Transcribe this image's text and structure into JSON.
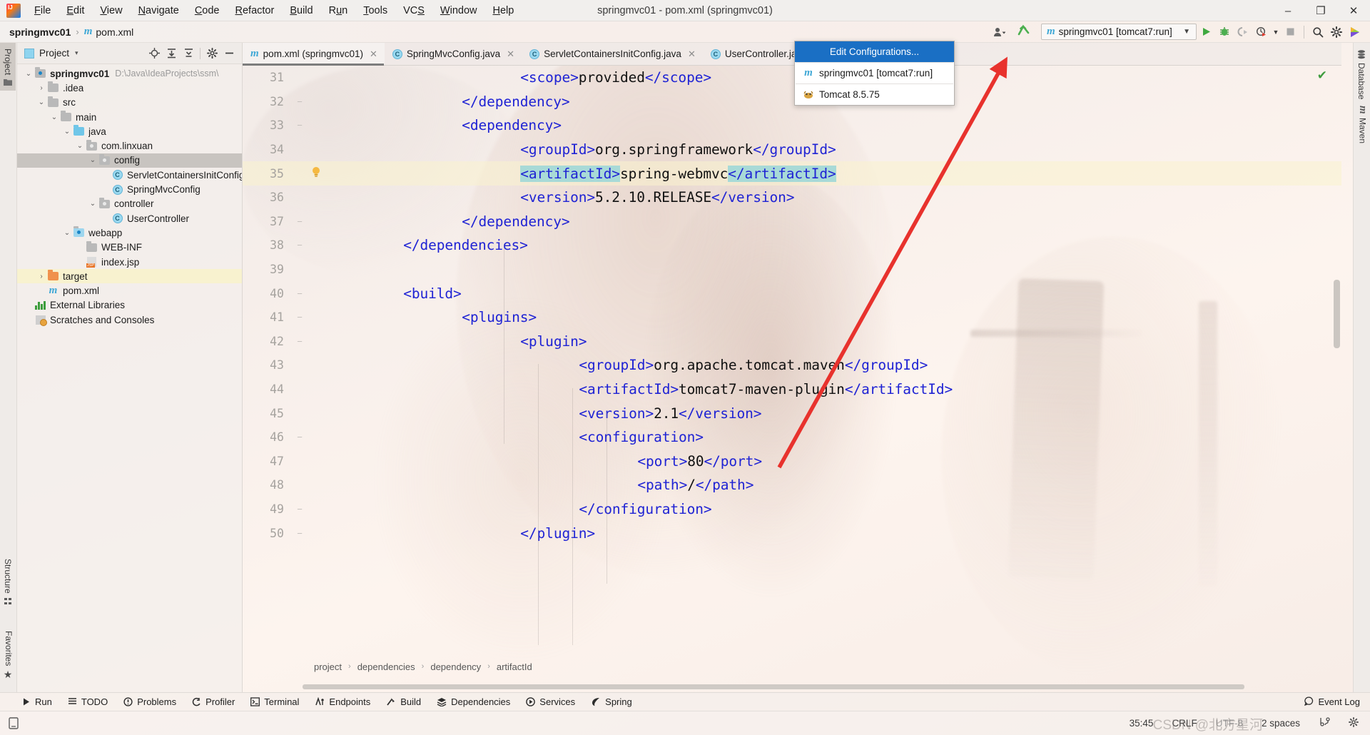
{
  "window": {
    "title": "springmvc01 - pom.xml (springmvc01)",
    "minimize": "–",
    "maximize": "❐",
    "close": "✕"
  },
  "menubar": {
    "items": [
      {
        "label": "File",
        "mnemonic": "F"
      },
      {
        "label": "Edit",
        "mnemonic": "E"
      },
      {
        "label": "View",
        "mnemonic": "V"
      },
      {
        "label": "Navigate",
        "mnemonic": "N"
      },
      {
        "label": "Code",
        "mnemonic": "C"
      },
      {
        "label": "Refactor",
        "mnemonic": "R"
      },
      {
        "label": "Build",
        "mnemonic": "B"
      },
      {
        "label": "Run",
        "mnemonic": "u"
      },
      {
        "label": "Tools",
        "mnemonic": "T"
      },
      {
        "label": "VCS",
        "mnemonic": "S"
      },
      {
        "label": "Window",
        "mnemonic": "W"
      },
      {
        "label": "Help",
        "mnemonic": "H"
      }
    ]
  },
  "navbar": {
    "project": "springmvc01",
    "separator": "›",
    "file": "pom.xml",
    "run_config_label": "springmvc01 [tomcat7:run]",
    "icons": [
      "people-icon",
      "dropdown-caret-icon",
      "arrow-up-green-icon",
      "run-icon",
      "debug-icon",
      "run-with-coverage-icon",
      "profiler-icon",
      "stop-icon",
      "search-everywhere-icon",
      "settings-icon",
      "updates-icon"
    ]
  },
  "run_config_dropdown": {
    "items": [
      {
        "label": "Edit Configurations...",
        "selected": true,
        "icon": "none"
      },
      {
        "label": "springmvc01 [tomcat7:run]",
        "selected": false,
        "icon": "maven-icon"
      },
      {
        "label": "Tomcat 8.5.75",
        "selected": false,
        "icon": "tomcat-icon"
      }
    ]
  },
  "left_strip": {
    "tabs": [
      {
        "label": "Project",
        "active": true,
        "icon": "folder-icon"
      },
      {
        "label": "Structure",
        "active": false,
        "icon": "structure-icon"
      },
      {
        "label": "Favorites",
        "active": false,
        "icon": "star-icon"
      }
    ]
  },
  "right_strip": {
    "tabs": [
      {
        "label": "Database",
        "icon": "database-icon"
      },
      {
        "label": "Maven",
        "icon": "maven-icon"
      }
    ]
  },
  "project_panel": {
    "header": {
      "title": "Project",
      "caret": "▾",
      "icons": [
        "locate-icon",
        "expand-all-icon",
        "collapse-all-icon",
        "gear-icon",
        "hide-icon"
      ]
    },
    "tree": [
      {
        "indent": 0,
        "twisty": "⌄",
        "icon": "project-folder-icon",
        "label": "springmvc01",
        "path": "D:\\Java\\IdeaProjects\\ssm\\",
        "bold": true,
        "state": "none"
      },
      {
        "indent": 1,
        "twisty": "›",
        "icon": "folder-icon",
        "label": ".idea",
        "path": "",
        "bold": false,
        "state": "none"
      },
      {
        "indent": 1,
        "twisty": "⌄",
        "icon": "folder-icon",
        "label": "src",
        "path": "",
        "bold": false,
        "state": "none"
      },
      {
        "indent": 2,
        "twisty": "⌄",
        "icon": "folder-icon",
        "label": "main",
        "path": "",
        "bold": false,
        "state": "none"
      },
      {
        "indent": 3,
        "twisty": "⌄",
        "icon": "source-folder-icon",
        "label": "java",
        "path": "",
        "bold": false,
        "state": "none"
      },
      {
        "indent": 4,
        "twisty": "⌄",
        "icon": "package-icon",
        "label": "com.linxuan",
        "path": "",
        "bold": false,
        "state": "none"
      },
      {
        "indent": 5,
        "twisty": "⌄",
        "icon": "package-icon",
        "label": "config",
        "path": "",
        "bold": false,
        "state": "selected-gray"
      },
      {
        "indent": 6,
        "twisty": "",
        "icon": "java-class-icon",
        "label": "ServletContainersInitConfig",
        "path": "",
        "bold": false,
        "state": "none"
      },
      {
        "indent": 6,
        "twisty": "",
        "icon": "java-class-icon",
        "label": "SpringMvcConfig",
        "path": "",
        "bold": false,
        "state": "none"
      },
      {
        "indent": 5,
        "twisty": "⌄",
        "icon": "package-icon",
        "label": "controller",
        "path": "",
        "bold": false,
        "state": "none"
      },
      {
        "indent": 6,
        "twisty": "",
        "icon": "java-class-icon",
        "label": "UserController",
        "path": "",
        "bold": false,
        "state": "none"
      },
      {
        "indent": 3,
        "twisty": "⌄",
        "icon": "webapp-folder-icon",
        "label": "webapp",
        "path": "",
        "bold": false,
        "state": "none"
      },
      {
        "indent": 4,
        "twisty": "",
        "icon": "folder-icon",
        "label": "WEB-INF",
        "path": "",
        "bold": false,
        "state": "none"
      },
      {
        "indent": 4,
        "twisty": "",
        "icon": "jsp-icon",
        "label": "index.jsp",
        "path": "",
        "bold": false,
        "state": "none"
      },
      {
        "indent": 1,
        "twisty": "›",
        "icon": "target-folder-icon",
        "label": "target",
        "path": "",
        "bold": false,
        "state": "selected-yellow"
      },
      {
        "indent": 1,
        "twisty": "",
        "icon": "maven-icon",
        "label": "pom.xml",
        "path": "",
        "bold": false,
        "state": "none"
      },
      {
        "indent": 0,
        "twisty": "",
        "icon": "libraries-icon",
        "label": "External Libraries",
        "path": "",
        "bold": false,
        "state": "none"
      },
      {
        "indent": 0,
        "twisty": "",
        "icon": "scratches-icon",
        "label": "Scratches and Consoles",
        "path": "",
        "bold": false,
        "state": "none"
      }
    ]
  },
  "editor": {
    "tabs": [
      {
        "label": "pom.xml (springmvc01)",
        "icon": "maven-icon",
        "active": true,
        "close": "✕"
      },
      {
        "label": "SpringMvcConfig.java",
        "icon": "java-class-icon",
        "active": false,
        "close": "✕"
      },
      {
        "label": "ServletContainersInitConfig.java",
        "icon": "java-class-icon",
        "active": false,
        "close": "✕"
      },
      {
        "label": "UserController.java",
        "icon": "java-class-icon",
        "active": false,
        "close": "✕"
      }
    ],
    "first_line_number": 31,
    "lines": [
      {
        "num": 31,
        "indent": 24,
        "fold": "",
        "bulb": false,
        "highlight": false,
        "segments": [
          {
            "t": "<",
            "c": "tag"
          },
          {
            "t": "scope",
            "c": "tag"
          },
          {
            "t": ">",
            "c": "tag"
          },
          {
            "t": "provided",
            "c": "plain"
          },
          {
            "t": "</",
            "c": "tag"
          },
          {
            "t": "scope",
            "c": "tag"
          },
          {
            "t": ">",
            "c": "tag"
          }
        ]
      },
      {
        "num": 32,
        "indent": 17,
        "fold": "−",
        "bulb": false,
        "highlight": false,
        "segments": [
          {
            "t": "</",
            "c": "tag"
          },
          {
            "t": "dependency",
            "c": "tag"
          },
          {
            "t": ">",
            "c": "tag"
          }
        ]
      },
      {
        "num": 33,
        "indent": 17,
        "fold": "−",
        "bulb": false,
        "highlight": false,
        "segments": [
          {
            "t": "<",
            "c": "tag"
          },
          {
            "t": "dependency",
            "c": "tag"
          },
          {
            "t": ">",
            "c": "tag"
          }
        ]
      },
      {
        "num": 34,
        "indent": 24,
        "fold": "",
        "bulb": false,
        "highlight": false,
        "segments": [
          {
            "t": "<",
            "c": "tag"
          },
          {
            "t": "groupId",
            "c": "tag"
          },
          {
            "t": ">",
            "c": "tag"
          },
          {
            "t": "org.springframework",
            "c": "plain"
          },
          {
            "t": "</",
            "c": "tag"
          },
          {
            "t": "groupId",
            "c": "tag"
          },
          {
            "t": ">",
            "c": "tag"
          }
        ]
      },
      {
        "num": 35,
        "indent": 24,
        "fold": "",
        "bulb": true,
        "highlight": true,
        "segments": [
          {
            "t": "<artifactId>",
            "c": "tag-sel"
          },
          {
            "t": "spring-webmvc",
            "c": "plain"
          },
          {
            "t": "</artifactId>",
            "c": "tag-sel"
          }
        ]
      },
      {
        "num": 36,
        "indent": 24,
        "fold": "",
        "bulb": false,
        "highlight": false,
        "segments": [
          {
            "t": "<",
            "c": "tag"
          },
          {
            "t": "version",
            "c": "tag"
          },
          {
            "t": ">",
            "c": "tag"
          },
          {
            "t": "5.2.10.RELEASE",
            "c": "plain"
          },
          {
            "t": "</",
            "c": "tag"
          },
          {
            "t": "version",
            "c": "tag"
          },
          {
            "t": ">",
            "c": "tag"
          }
        ]
      },
      {
        "num": 37,
        "indent": 17,
        "fold": "−",
        "bulb": false,
        "highlight": false,
        "segments": [
          {
            "t": "</",
            "c": "tag"
          },
          {
            "t": "dependency",
            "c": "tag"
          },
          {
            "t": ">",
            "c": "tag"
          }
        ]
      },
      {
        "num": 38,
        "indent": 10,
        "fold": "−",
        "bulb": false,
        "highlight": false,
        "segments": [
          {
            "t": "</",
            "c": "tag"
          },
          {
            "t": "dependencies",
            "c": "tag"
          },
          {
            "t": ">",
            "c": "tag"
          }
        ]
      },
      {
        "num": 39,
        "indent": 10,
        "fold": "",
        "bulb": false,
        "highlight": false,
        "segments": []
      },
      {
        "num": 40,
        "indent": 10,
        "fold": "−",
        "bulb": false,
        "highlight": false,
        "segments": [
          {
            "t": "<",
            "c": "tag"
          },
          {
            "t": "build",
            "c": "tag"
          },
          {
            "t": ">",
            "c": "tag"
          }
        ]
      },
      {
        "num": 41,
        "indent": 17,
        "fold": "−",
        "bulb": false,
        "highlight": false,
        "segments": [
          {
            "t": "<",
            "c": "tag"
          },
          {
            "t": "plugins",
            "c": "tag"
          },
          {
            "t": ">",
            "c": "tag"
          }
        ]
      },
      {
        "num": 42,
        "indent": 24,
        "fold": "−",
        "bulb": false,
        "highlight": false,
        "segments": [
          {
            "t": "<",
            "c": "tag"
          },
          {
            "t": "plugin",
            "c": "tag"
          },
          {
            "t": ">",
            "c": "tag"
          }
        ]
      },
      {
        "num": 43,
        "indent": 31,
        "fold": "",
        "bulb": false,
        "highlight": false,
        "segments": [
          {
            "t": "<",
            "c": "tag"
          },
          {
            "t": "groupId",
            "c": "tag"
          },
          {
            "t": ">",
            "c": "tag"
          },
          {
            "t": "org.apache.tomcat.maven",
            "c": "plain"
          },
          {
            "t": "</",
            "c": "tag"
          },
          {
            "t": "groupId",
            "c": "tag"
          },
          {
            "t": ">",
            "c": "tag"
          }
        ]
      },
      {
        "num": 44,
        "indent": 31,
        "fold": "",
        "bulb": false,
        "highlight": false,
        "segments": [
          {
            "t": "<",
            "c": "tag"
          },
          {
            "t": "artifactId",
            "c": "tag"
          },
          {
            "t": ">",
            "c": "tag"
          },
          {
            "t": "tomcat7-maven-plugin",
            "c": "plain"
          },
          {
            "t": "</",
            "c": "tag"
          },
          {
            "t": "artifactId",
            "c": "tag"
          },
          {
            "t": ">",
            "c": "tag"
          }
        ]
      },
      {
        "num": 45,
        "indent": 31,
        "fold": "",
        "bulb": false,
        "highlight": false,
        "segments": [
          {
            "t": "<",
            "c": "tag"
          },
          {
            "t": "version",
            "c": "tag"
          },
          {
            "t": ">",
            "c": "tag"
          },
          {
            "t": "2.1",
            "c": "plain"
          },
          {
            "t": "</",
            "c": "tag"
          },
          {
            "t": "version",
            "c": "tag"
          },
          {
            "t": ">",
            "c": "tag"
          }
        ]
      },
      {
        "num": 46,
        "indent": 31,
        "fold": "−",
        "bulb": false,
        "highlight": false,
        "segments": [
          {
            "t": "<",
            "c": "tag"
          },
          {
            "t": "configuration",
            "c": "tag"
          },
          {
            "t": ">",
            "c": "tag"
          }
        ]
      },
      {
        "num": 47,
        "indent": 38,
        "fold": "",
        "bulb": false,
        "highlight": false,
        "segments": [
          {
            "t": "<",
            "c": "tag"
          },
          {
            "t": "port",
            "c": "tag"
          },
          {
            "t": ">",
            "c": "tag"
          },
          {
            "t": "80",
            "c": "plain"
          },
          {
            "t": "</",
            "c": "tag"
          },
          {
            "t": "port",
            "c": "tag"
          },
          {
            "t": ">",
            "c": "tag"
          }
        ]
      },
      {
        "num": 48,
        "indent": 38,
        "fold": "",
        "bulb": false,
        "highlight": false,
        "segments": [
          {
            "t": "<",
            "c": "tag"
          },
          {
            "t": "path",
            "c": "tag"
          },
          {
            "t": ">",
            "c": "tag"
          },
          {
            "t": "/",
            "c": "plain"
          },
          {
            "t": "</",
            "c": "tag"
          },
          {
            "t": "path",
            "c": "tag"
          },
          {
            "t": ">",
            "c": "tag"
          }
        ]
      },
      {
        "num": 49,
        "indent": 31,
        "fold": "−",
        "bulb": false,
        "highlight": false,
        "segments": [
          {
            "t": "</",
            "c": "tag"
          },
          {
            "t": "configuration",
            "c": "tag"
          },
          {
            "t": ">",
            "c": "tag"
          }
        ]
      },
      {
        "num": 50,
        "indent": 24,
        "fold": "−",
        "bulb": false,
        "highlight": false,
        "segments": [
          {
            "t": "</",
            "c": "tag"
          },
          {
            "t": "plugin",
            "c": "tag"
          },
          {
            "t": ">",
            "c": "tag"
          }
        ]
      }
    ],
    "breadcrumb": [
      "project",
      "dependencies",
      "dependency",
      "artifactId"
    ],
    "breadcrumb_separator": "›"
  },
  "bottom_strip": {
    "buttons": [
      {
        "label": "Run",
        "icon": "run-icon"
      },
      {
        "label": "TODO",
        "icon": "todo-icon"
      },
      {
        "label": "Problems",
        "icon": "problems-icon"
      },
      {
        "label": "Profiler",
        "icon": "profiler-icon"
      },
      {
        "label": "Terminal",
        "icon": "terminal-icon"
      },
      {
        "label": "Endpoints",
        "icon": "endpoints-icon"
      },
      {
        "label": "Build",
        "icon": "build-icon"
      },
      {
        "label": "Dependencies",
        "icon": "dependencies-icon"
      },
      {
        "label": "Services",
        "icon": "services-icon"
      },
      {
        "label": "Spring",
        "icon": "spring-icon"
      }
    ],
    "event_log": "Event Log"
  },
  "statusbar": {
    "caret_position": "35:45",
    "line_separator": "CRLF",
    "encoding": "UTF-8",
    "indent": "2 spaces",
    "watermark": "CSDN @北方星河"
  },
  "colors": {
    "accent_blue": "#1a6fc4",
    "tag_blue": "#1f23d4",
    "selection_teal": "#a8dad7",
    "highlight_yellow": "#faf3cd",
    "annotation_red": "#e8322d",
    "run_green": "#3f9c3f"
  }
}
